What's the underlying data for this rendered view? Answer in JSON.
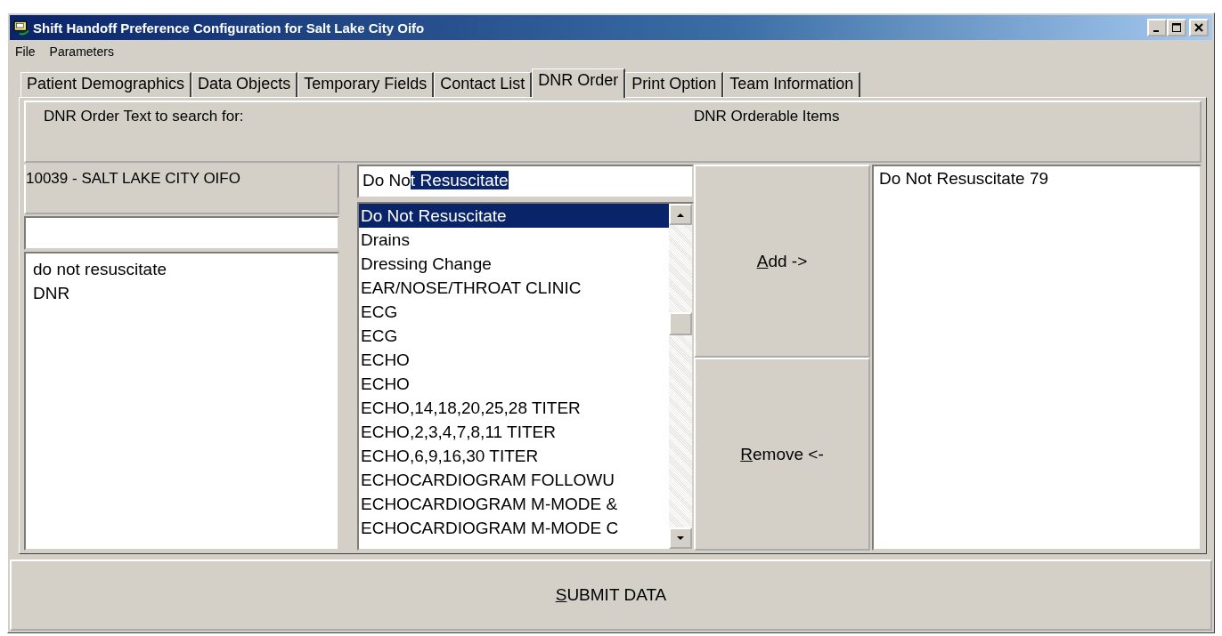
{
  "window": {
    "title": "Shift Handoff Preference Configuration for Salt Lake City Oifo"
  },
  "menu": [
    {
      "label": "File"
    },
    {
      "label": "Parameters"
    }
  ],
  "tabs": [
    {
      "label": "Patient Demographics",
      "selected": false
    },
    {
      "label": "Data Objects",
      "selected": false
    },
    {
      "label": "Temporary Fields",
      "selected": false
    },
    {
      "label": "Contact List",
      "selected": false
    },
    {
      "label": "DNR Order",
      "selected": true
    },
    {
      "label": "Print Option",
      "selected": false
    },
    {
      "label": "Team Information",
      "selected": false
    }
  ],
  "header": {
    "left": "DNR Order Text to search for:",
    "right": "DNR Orderable Items"
  },
  "site": {
    "label": "10039 - SALT LAKE CITY OIFO"
  },
  "search_texts": [
    {
      "text": "do not resuscitate"
    },
    {
      "text": "DNR"
    }
  ],
  "orderable_field": {
    "typed": "Do No",
    "autocompleted": "t Resuscitate"
  },
  "orderable_list": [
    {
      "text": "Do Not Resuscitate",
      "selected": true
    },
    {
      "text": "Drains",
      "selected": false
    },
    {
      "text": "Dressing Change",
      "selected": false
    },
    {
      "text": "EAR/NOSE/THROAT CLINIC",
      "selected": false
    },
    {
      "text": "ECG",
      "selected": false
    },
    {
      "text": "ECG",
      "selected": false
    },
    {
      "text": "ECHO",
      "selected": false
    },
    {
      "text": "ECHO",
      "selected": false
    },
    {
      "text": "ECHO,14,18,20,25,28 TITER",
      "selected": false
    },
    {
      "text": "ECHO,2,3,4,7,8,11 TITER",
      "selected": false
    },
    {
      "text": "ECHO,6,9,16,30 TITER",
      "selected": false
    },
    {
      "text": "ECHOCARDIOGRAM FOLLOWU",
      "selected": false
    },
    {
      "text": "ECHOCARDIOGRAM M-MODE &",
      "selected": false
    },
    {
      "text": "ECHOCARDIOGRAM M-MODE C",
      "selected": false
    }
  ],
  "buttons": [
    {
      "key": "A",
      "rest": "dd ->"
    },
    {
      "key": "R",
      "rest": "emove <-"
    }
  ],
  "chosen_items": [
    {
      "text": "Do Not Resuscitate 79"
    }
  ],
  "submit": {
    "key": "S",
    "rest": "UBMIT DATA"
  }
}
